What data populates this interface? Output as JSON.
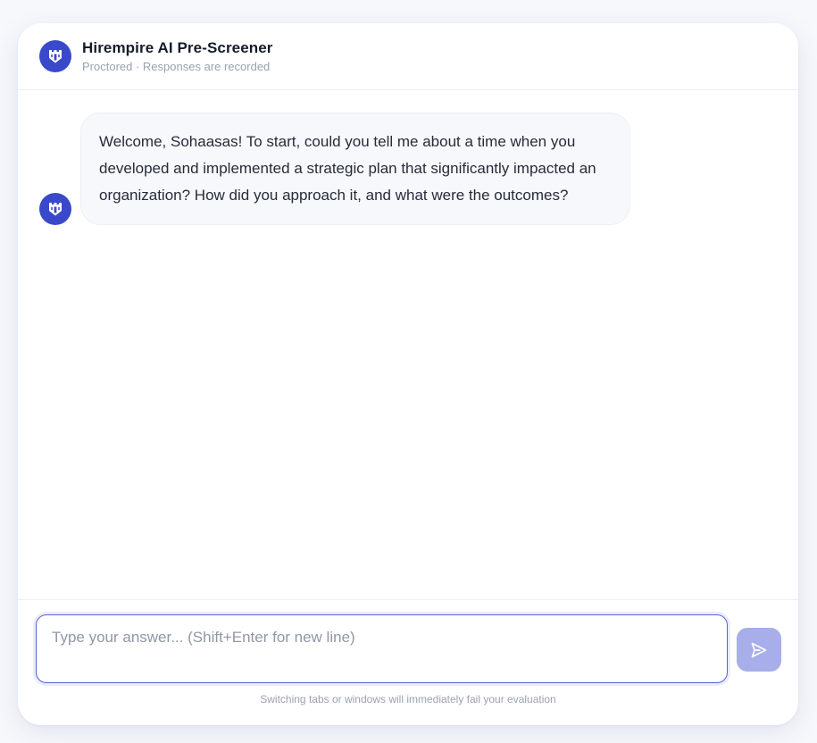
{
  "header": {
    "title": "Hirempire AI Pre-Screener",
    "subtitle": "Proctored · Responses are recorded",
    "avatar_icon": "castle-logo-icon"
  },
  "messages": [
    {
      "sender": "assistant",
      "avatar_icon": "castle-logo-icon",
      "text": "Welcome, Sohaasas! To start, could you tell me about a time when you developed and implemented a strategic plan that significantly impacted an organization? How did you approach it, and what were the outcomes?"
    }
  ],
  "composer": {
    "value": "",
    "placeholder": "Type your answer... (Shift+Enter for new line)",
    "send_icon": "send-icon",
    "warning": "Switching tabs or windows will immediately fail your evaluation"
  },
  "colors": {
    "brand": "#3a49c9",
    "input_focus_border": "#5563d8",
    "send_button_disabled": "#a8aee9",
    "bubble_background": "#f7f8fb"
  }
}
